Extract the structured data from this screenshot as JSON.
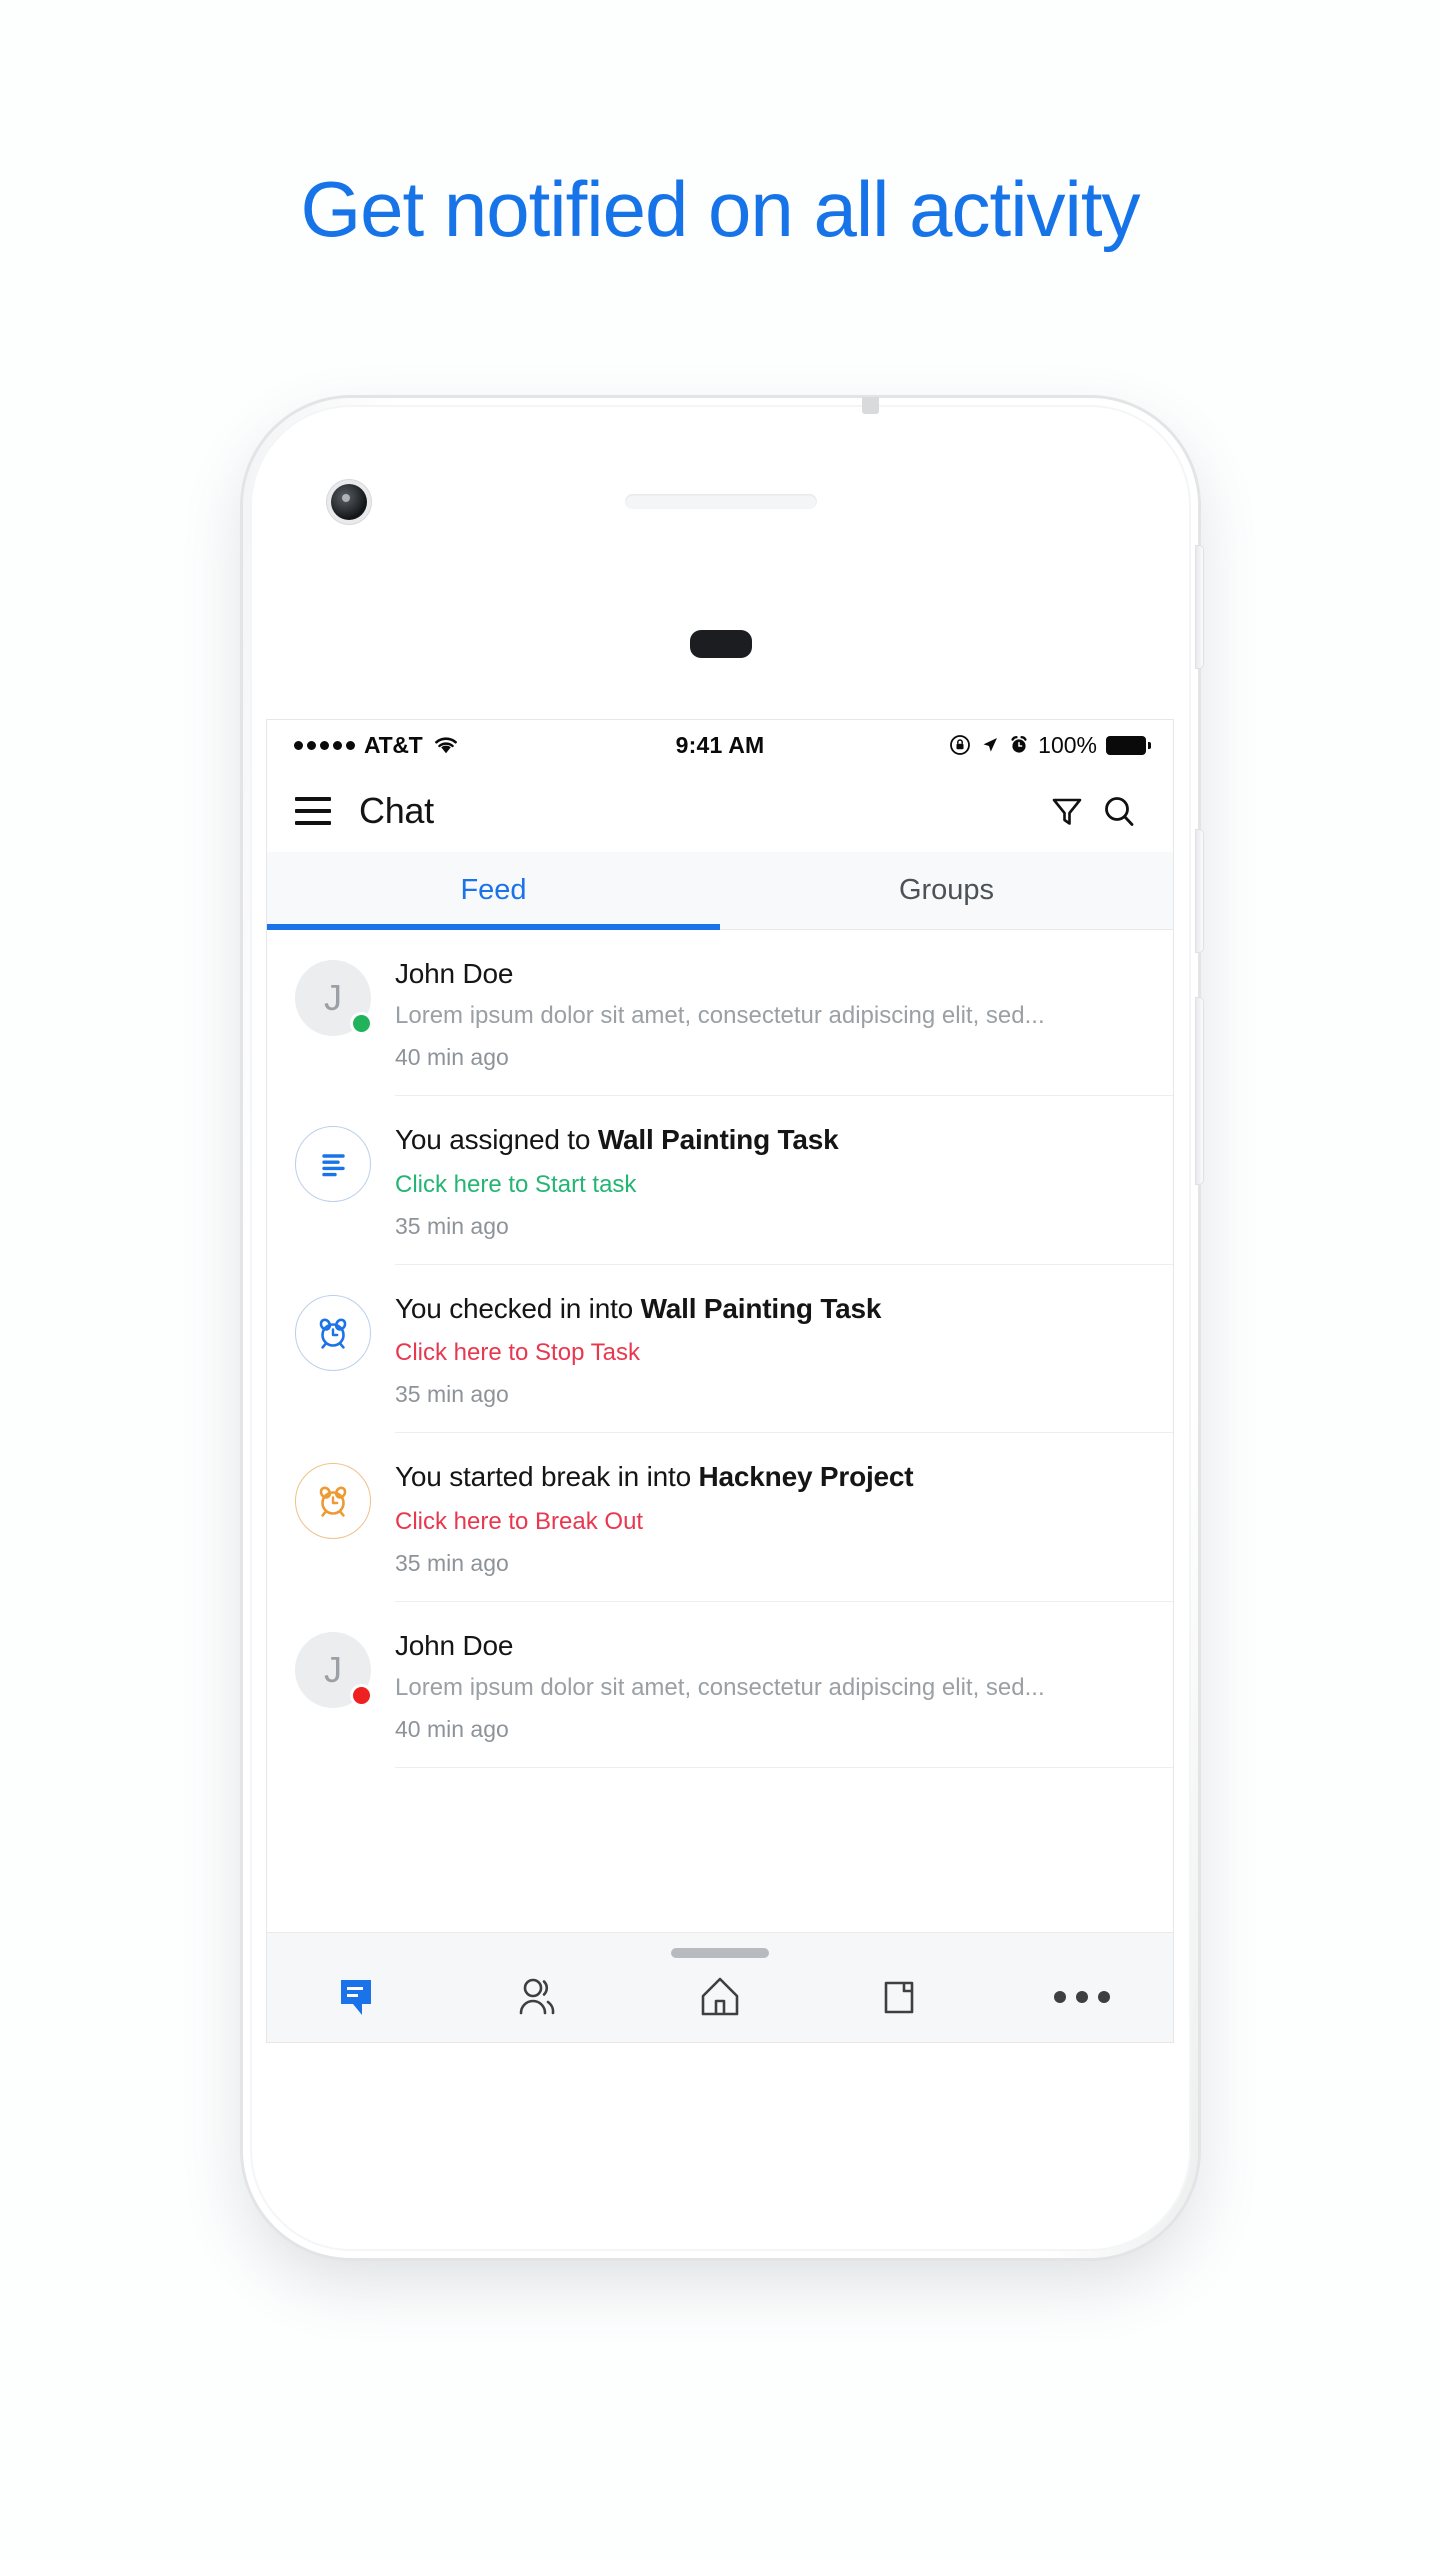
{
  "headline": "Get notified on all activity",
  "colors": {
    "accent_blue": "#1a73e8",
    "headline_blue": "#1674e8",
    "green": "#22b573",
    "red": "#e8384f",
    "amber": "#ee9a33",
    "muted": "#9aa0a6"
  },
  "status_bar": {
    "carrier": "AT&T",
    "signal_dots": 5,
    "wifi_icon": "wifi-icon",
    "time": "9:41 AM",
    "lock_icon": "rotation-lock-icon",
    "location_icon": "location-arrow-icon",
    "alarm_icon": "alarm-icon",
    "battery_percent": "100%"
  },
  "app_bar": {
    "menu_icon": "hamburger-menu-icon",
    "title": "Chat",
    "filter_icon": "filter-icon",
    "search_icon": "search-icon"
  },
  "tabs": [
    {
      "label": "Feed",
      "active": true
    },
    {
      "label": "Groups",
      "active": false
    }
  ],
  "feed": [
    {
      "icon_kind": "avatar",
      "icon_name": "avatar-john-doe",
      "avatar_initial": "J",
      "presence_color": "#21b35b",
      "title": "John Doe",
      "subtitle": "Lorem ipsum dolor sit amet, consectetur adipiscing elit, sed...",
      "time": "40 min ago"
    },
    {
      "icon_kind": "list",
      "icon_name": "task-list-icon",
      "title_prefix": "You assigned to ",
      "title_strong": "Wall Painting Task",
      "action": "Click here to Start task",
      "action_color": "green",
      "time": "35 min ago"
    },
    {
      "icon_kind": "alarm-blue",
      "icon_name": "alarm-clock-icon",
      "title_prefix": "You checked in into ",
      "title_strong": "Wall Painting Task",
      "action": "Click here to Stop Task",
      "action_color": "red",
      "time": "35 min ago"
    },
    {
      "icon_kind": "alarm-amber",
      "icon_name": "alarm-clock-break-icon",
      "title_prefix": "You started break in into ",
      "title_strong": "Hackney Project",
      "action": "Click here to Break Out",
      "action_color": "red",
      "time": "35 min ago"
    },
    {
      "icon_kind": "avatar",
      "icon_name": "avatar-john-doe",
      "avatar_initial": "J",
      "presence_color": "#ef2020",
      "title": "John Doe",
      "subtitle": "Lorem ipsum dolor sit amet, consectetur adipiscing elit, sed...",
      "time": "40 min ago"
    }
  ],
  "bottom_nav": [
    {
      "icon": "chat-bubble-icon",
      "active": true
    },
    {
      "icon": "people-icon",
      "active": false
    },
    {
      "icon": "home-icon",
      "active": false
    },
    {
      "icon": "folder-icon",
      "active": false
    },
    {
      "icon": "more-ellipsis-icon",
      "active": false
    }
  ]
}
